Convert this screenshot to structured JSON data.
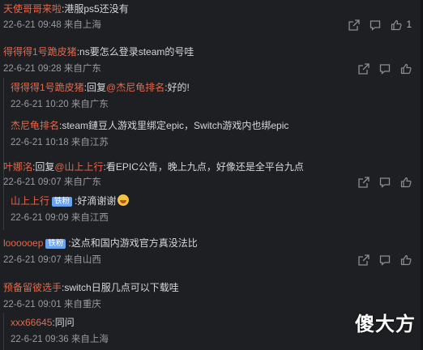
{
  "comments": [
    {
      "user": "天使哥哥来啦",
      "text": ":港服ps5还没有",
      "time": "22-6-21 09:48",
      "location": "来自上海",
      "like_count": "1"
    },
    {
      "user": "得得得1号跪皮猪",
      "text": ":ns要怎么登录steam的号哇",
      "time": "22-6-21 09:28",
      "location": "来自广东",
      "replies": [
        {
          "user": "得得得1号跪皮猪",
          "prefix": ":回复",
          "mention": "@杰尼龟排名",
          "text": ":好的!",
          "time": "22-6-21 10:20",
          "location": "来自广东"
        },
        {
          "user": "杰尼龟排名",
          "text": ":steam鏈豆人游戏里绑定epic，Switch游戏内也绑epic",
          "time": "22-6-21 10:18",
          "location": "来自江苏"
        }
      ]
    },
    {
      "user": "叶娜洺",
      "prefix": ":回复",
      "mention": "@山上上行",
      "text": ":看EPIC公告，晚上九点，好像还是全平台九点",
      "time": "22-6-21 09:07",
      "location": "来自广东",
      "replies": [
        {
          "user": "山上上行",
          "badge": "铁粉",
          "text": ":好滴谢谢",
          "emoji": "happy-face",
          "time": "22-6-21 09:09",
          "location": "来自江西"
        }
      ]
    },
    {
      "user": "loooooep",
      "badge": "铁粉",
      "text": ":这点和国内游戏官方真没法比",
      "time": "22-6-21 09:07",
      "location": "来自山西"
    },
    {
      "user": "预备留彼选手",
      "text": ":switch日服几点可以下载哇",
      "time": "22-6-21 09:01",
      "location": "来自重庆",
      "replies": [
        {
          "user": "xxx66645",
          "text": ":同问",
          "time": "22-6-21 09:36",
          "location": "来自上海"
        }
      ]
    }
  ],
  "watermark": "傻大方",
  "colors": {
    "username": "#e2694c",
    "badge": "#6aa4ee",
    "background": "#1e1f23"
  }
}
